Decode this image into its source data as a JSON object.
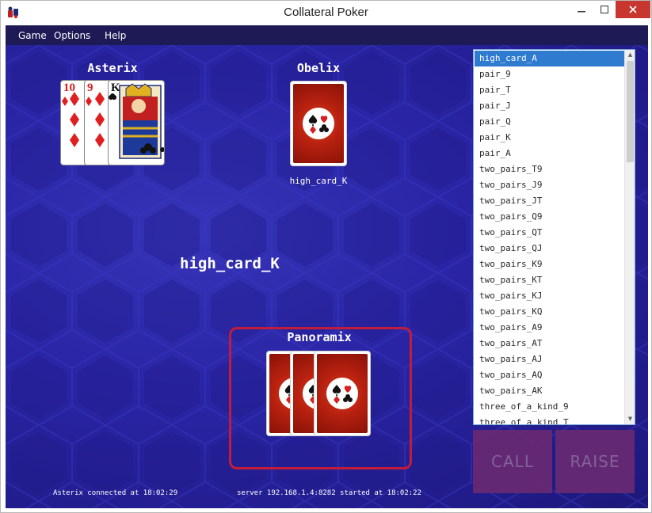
{
  "window": {
    "title": "Collateral Poker"
  },
  "menu": {
    "items": [
      "Game",
      "Options",
      "Help"
    ]
  },
  "players": {
    "top_left": {
      "name": "Asterix",
      "cards": [
        {
          "rank": "10",
          "suit": "diamonds"
        },
        {
          "rank": "9",
          "suit": "diamonds"
        },
        {
          "rank": "K",
          "suit": "clubs"
        }
      ]
    },
    "top_center": {
      "name": "Obelix",
      "hand": "high_card_K"
    },
    "bottom": {
      "name": "Panoramix"
    }
  },
  "table": {
    "current_hand": "high_card_K"
  },
  "hand_list": {
    "selected": "high_card_A",
    "items": [
      "high_card_A",
      "pair_9",
      "pair_T",
      "pair_J",
      "pair_Q",
      "pair_K",
      "pair_A",
      "two_pairs_T9",
      "two_pairs_J9",
      "two_pairs_JT",
      "two_pairs_Q9",
      "two_pairs_QT",
      "two_pairs_QJ",
      "two_pairs_K9",
      "two_pairs_KT",
      "two_pairs_KJ",
      "two_pairs_KQ",
      "two_pairs_A9",
      "two_pairs_AT",
      "two_pairs_AJ",
      "two_pairs_AQ",
      "two_pairs_AK",
      "three_of_a_kind_9",
      "three_of_a_kind_T"
    ]
  },
  "actions": {
    "call": "CALL",
    "raise": "RAISE"
  },
  "status": {
    "left": "Asterix connected at 18:02:29",
    "center": "server 192.168.1.4:8282 started at 18:02:22"
  },
  "colors": {
    "felt": "#2a25a6",
    "menubar": "#1d1a55",
    "highlight": "#c21c3a",
    "list_selection": "#2e7bd0",
    "card_back": "#b8210f",
    "action_button": "#6a2a72"
  }
}
